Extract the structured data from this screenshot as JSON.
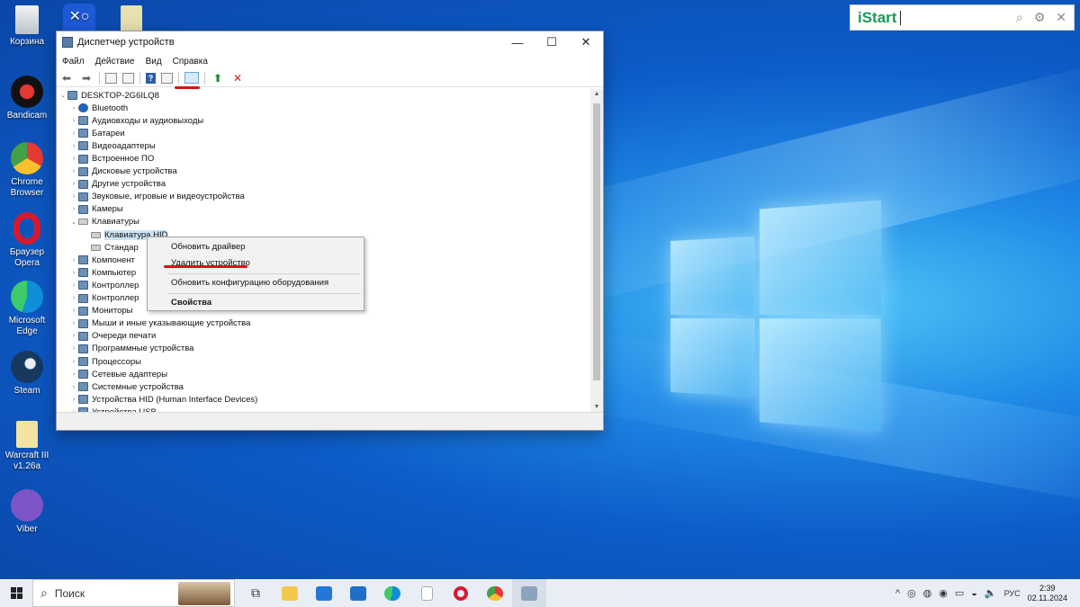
{
  "desktop": {
    "icons": [
      {
        "label": "Корзина"
      },
      {
        "label": ""
      },
      {
        "label": ""
      },
      {
        "label": "Bandicam"
      },
      {
        "label": "Chrome Browser"
      },
      {
        "label": "Браузер Opera"
      },
      {
        "label": "Microsoft Edge"
      },
      {
        "label": "Steam"
      },
      {
        "label": "Warcraft III v1.26a"
      },
      {
        "label": "Viber"
      }
    ]
  },
  "istart": {
    "brand": "iStart",
    "icons": [
      "search-icon",
      "gear-icon",
      "close-icon"
    ]
  },
  "window": {
    "title": "Диспетчер устройств",
    "controls": {
      "minimize": "—",
      "maximize": "☐",
      "close": "✕"
    },
    "menu": [
      "Файл",
      "Действие",
      "Вид",
      "Справка"
    ],
    "tree": {
      "root": "DESKTOP-2G6ILQ8",
      "items": [
        {
          "label": "Bluetooth",
          "expanded": false
        },
        {
          "label": "Аудиовходы и аудиовыходы",
          "expanded": false
        },
        {
          "label": "Батареи",
          "expanded": false
        },
        {
          "label": "Видеоадаптеры",
          "expanded": false
        },
        {
          "label": "Встроенное ПО",
          "expanded": false
        },
        {
          "label": "Дисковые устройства",
          "expanded": false
        },
        {
          "label": "Другие устройства",
          "expanded": false
        },
        {
          "label": "Звуковые, игровые и видеоустройства",
          "expanded": false
        },
        {
          "label": "Камеры",
          "expanded": false
        },
        {
          "label": "Клавиатуры",
          "expanded": true
        },
        {
          "label": "Клавиатура HID",
          "child": true,
          "selected": true
        },
        {
          "label": "Стандар",
          "child": true
        },
        {
          "label": "Компонент",
          "expanded": false
        },
        {
          "label": "Компьютер",
          "expanded": false
        },
        {
          "label": "Контроллер",
          "expanded": false
        },
        {
          "label": "Контроллер",
          "expanded": false
        },
        {
          "label": "Мониторы",
          "expanded": false
        },
        {
          "label": "Мыши и иные указывающие устройства",
          "expanded": false
        },
        {
          "label": "Очереди печати",
          "expanded": false
        },
        {
          "label": "Программные устройства",
          "expanded": false
        },
        {
          "label": "Процессоры",
          "expanded": false
        },
        {
          "label": "Сетевые адаптеры",
          "expanded": false
        },
        {
          "label": "Системные устройства",
          "expanded": false
        },
        {
          "label": "Устройства HID (Human Interface Devices)",
          "expanded": false
        },
        {
          "label": "Устройства USB",
          "expanded": false
        }
      ]
    }
  },
  "context_menu": {
    "update_driver": "Обновить драйвер",
    "uninstall_device": "Удалить устройство",
    "scan_hardware": "Обновить конфигурацию оборудования",
    "properties": "Свойства"
  },
  "taskbar": {
    "search_placeholder": "Поиск",
    "language": "РУС",
    "time": "2:39",
    "date": "02.11.2024"
  }
}
